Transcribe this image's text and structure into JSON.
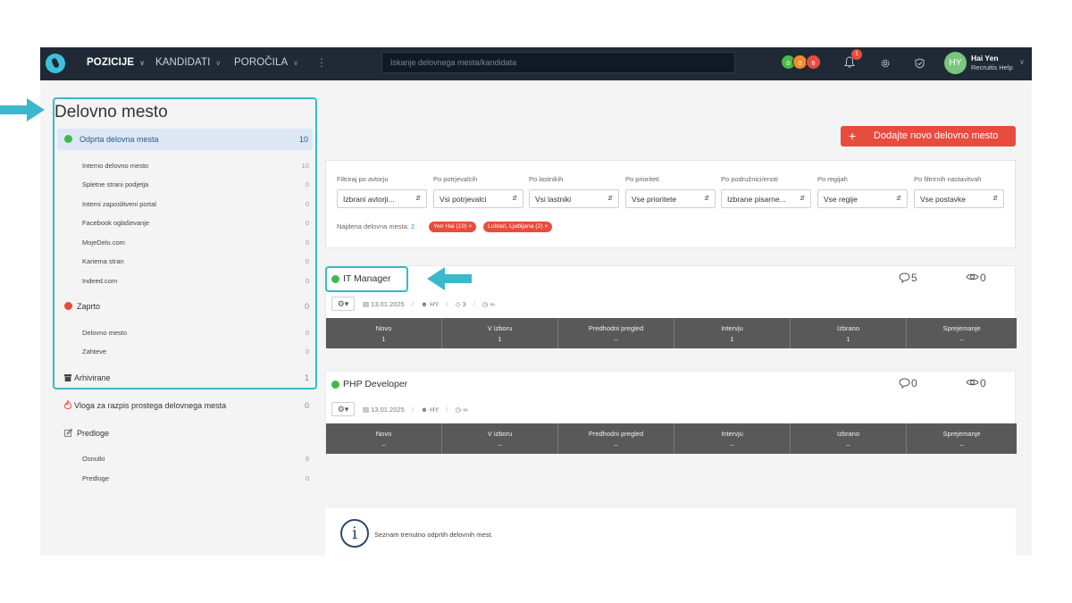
{
  "nav": {
    "items": [
      "POZICIJE",
      "KANDIDATI",
      "POROČILA"
    ],
    "more": "⋮",
    "search_placeholder": "Iskanje delovnega mesta/kandidata",
    "badges": [
      "0",
      "0",
      "6"
    ],
    "bell_count": "1",
    "user_initials": "HY",
    "user_name": "Hai Yen",
    "user_org": "Recruitis Help"
  },
  "sidebar": {
    "title": "Delovno mesto",
    "open": {
      "label": "Odprta delovna mesta",
      "count": "10"
    },
    "open_sources": [
      {
        "label": "Interno delovno mesto",
        "count": "10"
      },
      {
        "label": "Spletne strani podjetja",
        "count": "0"
      },
      {
        "label": "Interni zaposlitveni portal",
        "count": "0"
      },
      {
        "label": "Facebook oglaševanje",
        "count": "0"
      },
      {
        "label": "MojeDelo.com",
        "count": "0"
      },
      {
        "label": "Kariema stran",
        "count": "0"
      },
      {
        "label": "Indeed.com",
        "count": "0"
      }
    ],
    "closed": {
      "label": "Zaprto",
      "count": "0"
    },
    "closed_items": [
      {
        "label": "Delovno mesto",
        "count": "0"
      },
      {
        "label": "Zahteve",
        "count": "0"
      }
    ],
    "archived": {
      "label": "Arhivirane",
      "count": "1"
    },
    "request": {
      "label": "Vloga za razpis prostega delovnega mesta",
      "count": "0"
    },
    "templates": {
      "label": "Predloge"
    },
    "template_items": [
      {
        "label": "Osnutki",
        "count": "8"
      },
      {
        "label": "Predloge",
        "count": "0"
      }
    ]
  },
  "actions": {
    "add_position": "Dodajte novo delovno mesto"
  },
  "filters": [
    {
      "label": "Filtriraj po avtorju",
      "value": "Izbrani avtorji..."
    },
    {
      "label": "Po potrjevalcih",
      "value": "Vsi potrjevalci"
    },
    {
      "label": "Po lastnikih",
      "value": "Vsi lastniki"
    },
    {
      "label": "Po prioriteti",
      "value": "Vse prioritete"
    },
    {
      "label": "Po podružnici/enoti",
      "value": "Izbrane pisarne..."
    },
    {
      "label": "Po regijah",
      "value": "Vse regije"
    },
    {
      "label": "Po filtrirnih nastavitvah",
      "value": "Vse postavke"
    }
  ],
  "found": {
    "label": "Najdena delovna mesta:",
    "count": "2"
  },
  "active_tags": [
    "Yen Hai (10) ×",
    "Lublań, Ljubljana (2) ×"
  ],
  "stage_names": [
    "Novo",
    "V izboru",
    "Predhodni pregled",
    "Intervju",
    "Izbrano",
    "Sprejemanje"
  ],
  "positions": [
    {
      "title": "IT Manager",
      "comments": "5",
      "views": "0",
      "date": "13.01.2025",
      "owner": "HY",
      "tags": "3",
      "timer": "∞",
      "stage_values": [
        "1",
        "1",
        "–",
        "1",
        "1",
        "–"
      ]
    },
    {
      "title": "PHP Developer",
      "comments": "0",
      "views": "0",
      "date": "13.01.2025",
      "owner": "HY",
      "timer": "∞",
      "stage_values": [
        "–",
        "–",
        "–",
        "–",
        "–",
        "–"
      ]
    }
  ],
  "info": {
    "text": "Seznam trenutno odprtih delovnih mest."
  },
  "colors": {
    "accent_red": "#e84c3d",
    "highlight": "#3ab8cc",
    "nav_bg": "#1f2a36",
    "status_green": "#3fba4a"
  }
}
